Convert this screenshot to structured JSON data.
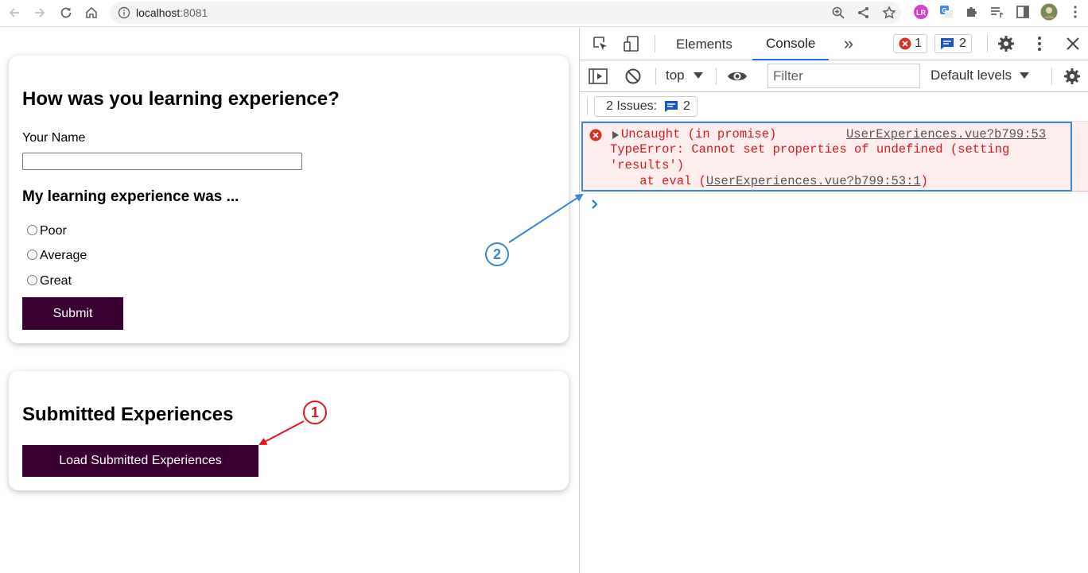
{
  "browser": {
    "url_host": "localhost",
    "url_port": ":8081"
  },
  "page": {
    "feedback_form": {
      "title": "How was you learning experience?",
      "name_label": "Your Name",
      "name_value": "",
      "rating_title": "My learning experience was ...",
      "options": [
        "Poor",
        "Average",
        "Great"
      ],
      "submit_label": "Submit"
    },
    "submitted": {
      "title": "Submitted Experiences",
      "load_label": "Load Submitted Experiences"
    }
  },
  "annotations": {
    "marker1": "1",
    "marker2": "2",
    "marker1_color": "#e0161b",
    "marker2_color": "#3a86d4"
  },
  "devtools": {
    "tabs": [
      "Elements",
      "Console"
    ],
    "active_tab": "Console",
    "error_count": "1",
    "message_count": "2",
    "context": "top",
    "filter_placeholder": "Filter",
    "levels": "Default levels",
    "issues_label": "2 Issues:",
    "issues_count": "2",
    "console": {
      "line1": "Uncaught (in promise)",
      "source": "UserExperiences.vue?b799:53",
      "line2": "TypeError: Cannot set properties of undefined (setting",
      "line3": "'results')",
      "line4_prefix": "    at eval (",
      "line4_link": "UserExperiences.vue?b799:53:1",
      "line4_suffix": ")"
    }
  }
}
